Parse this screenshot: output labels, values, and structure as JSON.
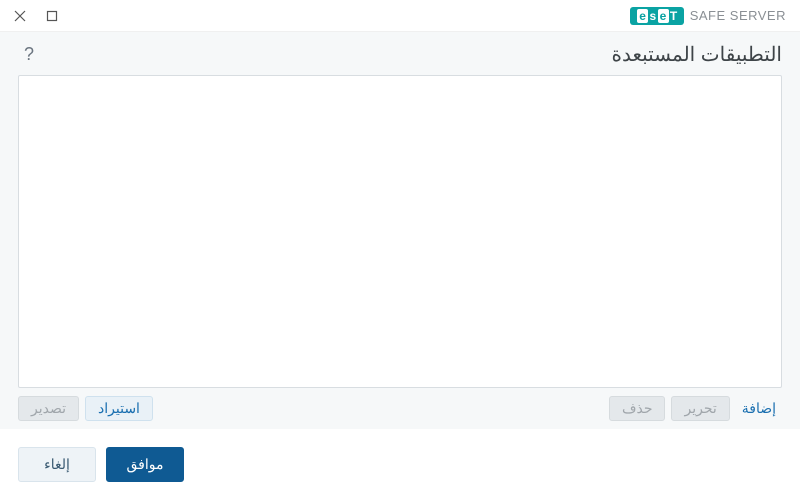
{
  "brand": {
    "name": "ESET",
    "product": "SAFE SERVER"
  },
  "header": {
    "title": "التطبيقات المستبعدة"
  },
  "actions": {
    "add": "إضافة",
    "edit": "تحرير",
    "delete": "حذف",
    "import": "استيراد",
    "export": "تصدير"
  },
  "footer": {
    "ok": "موافق",
    "cancel": "إلغاء"
  }
}
